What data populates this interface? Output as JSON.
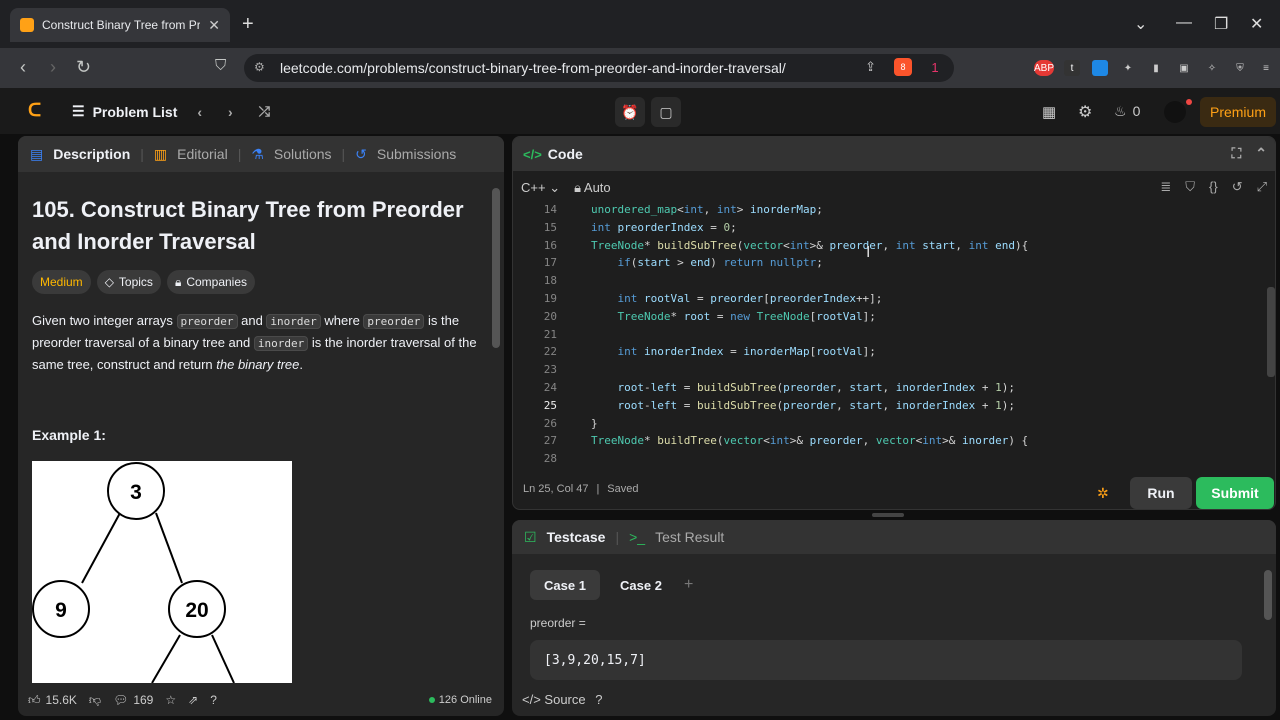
{
  "browser": {
    "tab_title": "Construct Binary Tree from Prec",
    "tab_close": "✕",
    "new_tab": "+",
    "url": "leetcode.com/problems/construct-binary-tree-from-preorder-and-inorder-traversal/",
    "brave_badge": "8",
    "alert_badge": "1",
    "ext_abp": "ABP",
    "ext_t": "t"
  },
  "header": {
    "problem_list": "Problem List",
    "streak": "0",
    "premium": "Premium"
  },
  "left_tabs": {
    "description": "Description",
    "editorial": "Editorial",
    "solutions": "Solutions",
    "submissions": "Submissions"
  },
  "problem": {
    "title": "105. Construct Binary Tree from Preorder and Inorder Traversal",
    "difficulty": "Medium",
    "topics": "Topics",
    "companies": "Companies",
    "desc_1": "Given two integer arrays ",
    "code_preorder": "preorder",
    "desc_2": " and ",
    "code_inorder": "inorder",
    "desc_3": " where ",
    "desc_4": " is the preorder traversal of a binary tree and ",
    "desc_5": " is the inorder traversal of the same tree, construct and return ",
    "desc_emph": "the binary tree",
    "desc_end": ".",
    "example_label": "Example 1:",
    "tree_nodes": [
      "3",
      "9",
      "20"
    ]
  },
  "left_footer": {
    "likes": "15.6K",
    "comments": "169",
    "online": "126 Online"
  },
  "code": {
    "panel_title": "Code",
    "language": "C++",
    "mode": "Auto",
    "status_position": "Ln 25, Col 47",
    "status_saved": "Saved",
    "run": "Run",
    "submit": "Submit",
    "lines": [
      {
        "n": "14",
        "indent": "",
        "tokens": [
          [
            "ty",
            "unordered_map"
          ],
          [
            "",
            "<"
          ],
          [
            "kw",
            "int"
          ],
          [
            "",
            ", "
          ],
          [
            "kw",
            "int"
          ],
          [
            "",
            "> "
          ],
          [
            "vr",
            "inorderMap"
          ],
          [
            "",
            ";"
          ]
        ]
      },
      {
        "n": "15",
        "indent": "",
        "tokens": [
          [
            "kw",
            "int"
          ],
          [
            "",
            " "
          ],
          [
            "vr",
            "preorderIndex"
          ],
          [
            "",
            " = "
          ],
          [
            "nm",
            "0"
          ],
          [
            "",
            ";"
          ]
        ]
      },
      {
        "n": "16",
        "indent": "",
        "tokens": [
          [
            "ty",
            "TreeNode"
          ],
          [
            "",
            "* "
          ],
          [
            "fn",
            "buildSubTree"
          ],
          [
            "",
            "("
          ],
          [
            "ty",
            "vector"
          ],
          [
            "",
            "<"
          ],
          [
            "kw",
            "int"
          ],
          [
            "",
            ">& "
          ],
          [
            "vr",
            "preorder"
          ],
          [
            "",
            ", "
          ],
          [
            "kw",
            "int"
          ],
          [
            "",
            " "
          ],
          [
            "vr",
            "start"
          ],
          [
            "",
            ", "
          ],
          [
            "kw",
            "int"
          ],
          [
            "",
            " "
          ],
          [
            "vr",
            "end"
          ],
          [
            "",
            "){"
          ]
        ]
      },
      {
        "n": "17",
        "indent": "    ",
        "tokens": [
          [
            "kw",
            "if"
          ],
          [
            "",
            "("
          ],
          [
            "vr",
            "start"
          ],
          [
            "",
            " > "
          ],
          [
            "vr",
            "end"
          ],
          [
            "",
            ") "
          ],
          [
            "kw",
            "return"
          ],
          [
            "",
            " "
          ],
          [
            "kw",
            "nullptr"
          ],
          [
            "",
            ";"
          ]
        ]
      },
      {
        "n": "18",
        "indent": "",
        "tokens": []
      },
      {
        "n": "19",
        "indent": "    ",
        "tokens": [
          [
            "kw",
            "int"
          ],
          [
            "",
            " "
          ],
          [
            "vr",
            "rootVal"
          ],
          [
            "",
            " = "
          ],
          [
            "vr",
            "preorder"
          ],
          [
            "",
            "["
          ],
          [
            "vr",
            "preorderIndex"
          ],
          [
            "",
            "++];"
          ]
        ]
      },
      {
        "n": "20",
        "indent": "    ",
        "tokens": [
          [
            "ty",
            "TreeNode"
          ],
          [
            "",
            "* "
          ],
          [
            "vr",
            "root"
          ],
          [
            "",
            " = "
          ],
          [
            "kw",
            "new"
          ],
          [
            "",
            " "
          ],
          [
            "ty",
            "TreeNode"
          ],
          [
            "",
            "["
          ],
          [
            "vr",
            "rootVal"
          ],
          [
            "",
            "];"
          ]
        ]
      },
      {
        "n": "21",
        "indent": "",
        "tokens": []
      },
      {
        "n": "22",
        "indent": "    ",
        "tokens": [
          [
            "kw",
            "int"
          ],
          [
            "",
            " "
          ],
          [
            "vr",
            "inorderIndex"
          ],
          [
            "",
            " = "
          ],
          [
            "vr",
            "inorderMap"
          ],
          [
            "",
            "["
          ],
          [
            "vr",
            "rootVal"
          ],
          [
            "",
            "];"
          ]
        ]
      },
      {
        "n": "23",
        "indent": "",
        "tokens": []
      },
      {
        "n": "24",
        "indent": "    ",
        "tokens": [
          [
            "vr",
            "root"
          ],
          [
            "",
            "-"
          ],
          [
            "vr",
            "left"
          ],
          [
            "",
            " = "
          ],
          [
            "fn",
            "buildSubTree"
          ],
          [
            "",
            "("
          ],
          [
            "vr",
            "preorder"
          ],
          [
            "",
            ", "
          ],
          [
            "vr",
            "start"
          ],
          [
            "",
            ", "
          ],
          [
            "vr",
            "inorderIndex"
          ],
          [
            "",
            " + "
          ],
          [
            "nm",
            "1"
          ],
          [
            "",
            ");"
          ]
        ]
      },
      {
        "n": "25",
        "indent": "    ",
        "tokens": [
          [
            "vr",
            "root"
          ],
          [
            "",
            "-"
          ],
          [
            "vr",
            "left"
          ],
          [
            "",
            " = "
          ],
          [
            "fn",
            "buildSubTree"
          ],
          [
            "",
            "("
          ],
          [
            "vr",
            "preorder"
          ],
          [
            "",
            ", "
          ],
          [
            "vr",
            "start"
          ],
          [
            "",
            ", "
          ],
          [
            "vr",
            "inorderIndex"
          ],
          [
            "",
            " + "
          ],
          [
            "nm",
            "1"
          ],
          [
            "",
            ");"
          ]
        ]
      },
      {
        "n": "26",
        "indent": "",
        "tokens": [
          [
            "",
            "}"
          ]
        ]
      },
      {
        "n": "27",
        "indent": "",
        "tokens": [
          [
            "ty",
            "TreeNode"
          ],
          [
            "",
            "* "
          ],
          [
            "fn",
            "buildTree"
          ],
          [
            "",
            "("
          ],
          [
            "ty",
            "vector"
          ],
          [
            "",
            "<"
          ],
          [
            "kw",
            "int"
          ],
          [
            "",
            ">& "
          ],
          [
            "vr",
            "preorder"
          ],
          [
            "",
            ", "
          ],
          [
            "ty",
            "vector"
          ],
          [
            "",
            "<"
          ],
          [
            "kw",
            "int"
          ],
          [
            "",
            ">& "
          ],
          [
            "vr",
            "inorder"
          ],
          [
            "",
            ") {"
          ]
        ]
      },
      {
        "n": "28",
        "indent": "",
        "tokens": []
      }
    ]
  },
  "testcase": {
    "tab_testcase": "Testcase",
    "tab_result": "Test Result",
    "case1": "Case 1",
    "case2": "Case 2",
    "add": "+",
    "label": "preorder =",
    "value": "[3,9,20,15,7]",
    "source": "Source"
  }
}
